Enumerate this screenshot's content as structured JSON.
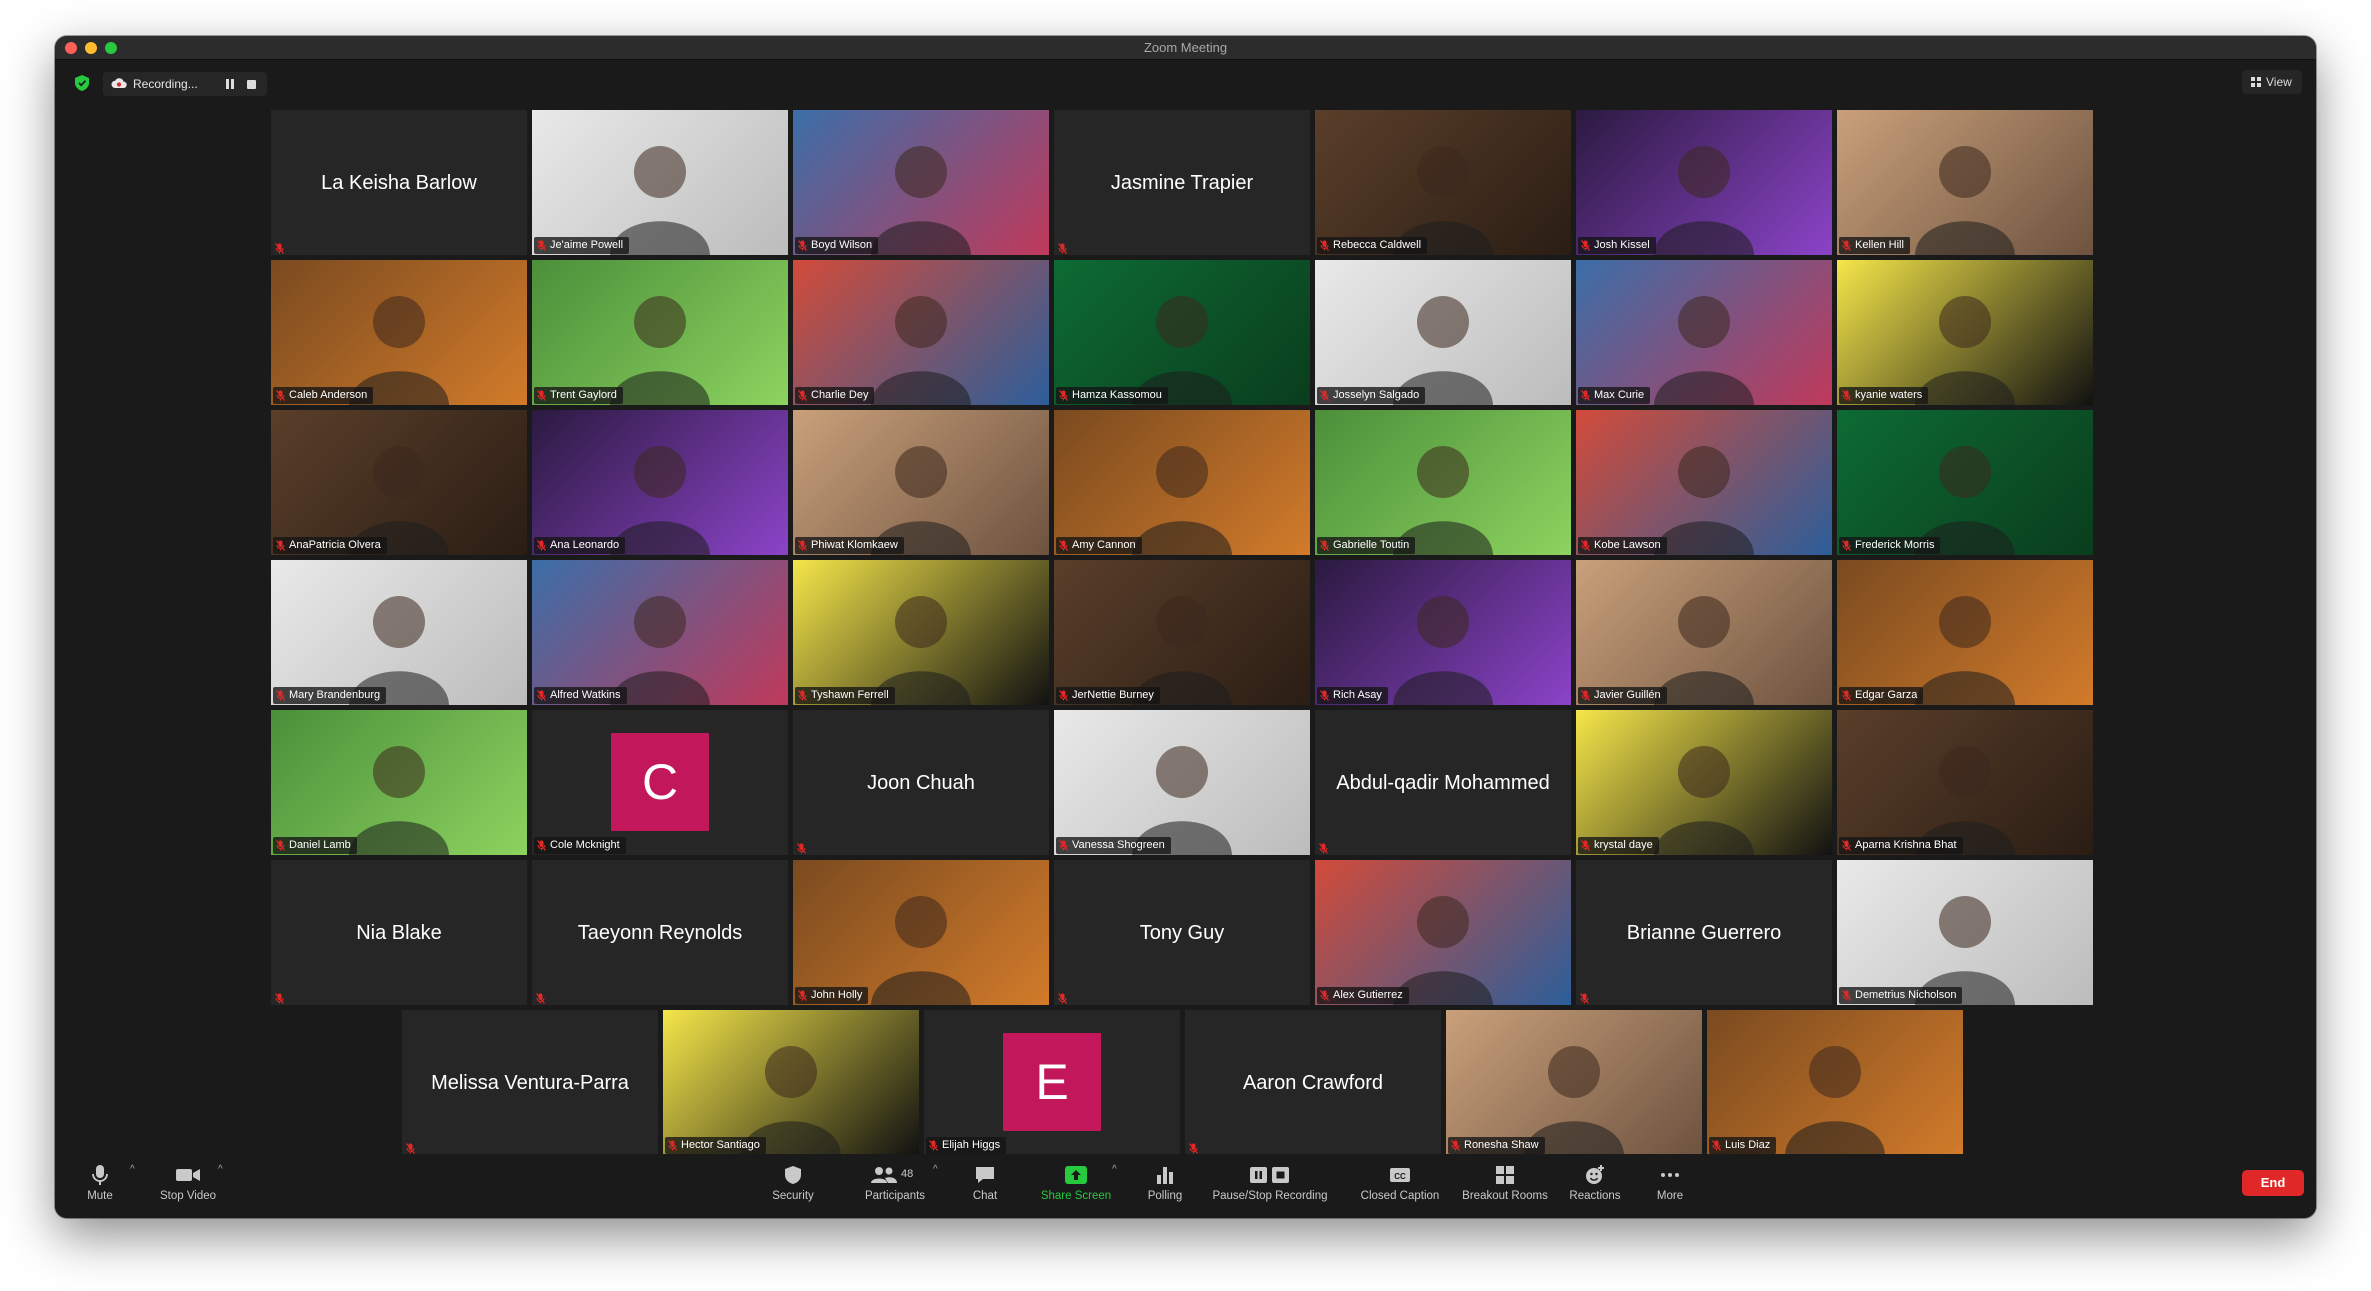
{
  "window": {
    "title": "Zoom Meeting"
  },
  "topbar": {
    "recording_label": "Recording...",
    "view_label": "View"
  },
  "colors": {
    "accent_green": "#27c93f",
    "end_red": "#e02828",
    "active_border": "#cddc39",
    "avatar_pink": "#c2185b"
  },
  "participants": [
    {
      "name": "La Keisha Barlow",
      "video": false
    },
    {
      "name": "Je'aime Powell",
      "video": true
    },
    {
      "name": "Boyd Wilson",
      "video": true
    },
    {
      "name": "Jasmine Trapier",
      "video": false
    },
    {
      "name": "Rebecca Caldwell",
      "video": true
    },
    {
      "name": "Josh Kissel",
      "video": true
    },
    {
      "name": "Kellen Hill",
      "video": true
    },
    {
      "name": "Caleb Anderson",
      "video": true
    },
    {
      "name": "Trent Gaylord",
      "video": true
    },
    {
      "name": "Charlie Dey",
      "video": true
    },
    {
      "name": "Hamza Kassomou",
      "video": true
    },
    {
      "name": "Josselyn Salgado",
      "video": true
    },
    {
      "name": "Max Curie",
      "video": true
    },
    {
      "name": "kyanie waters",
      "video": true
    },
    {
      "name": "AnaPatricia Olvera",
      "video": true
    },
    {
      "name": "Ana Leonardo",
      "video": true
    },
    {
      "name": "Phiwat Klomkaew",
      "video": true
    },
    {
      "name": "Amy Cannon",
      "video": true,
      "active": true
    },
    {
      "name": "Gabrielle Toutin",
      "video": true
    },
    {
      "name": "Kobe Lawson",
      "video": true
    },
    {
      "name": "Frederick Morris",
      "video": true
    },
    {
      "name": "Mary Brandenburg",
      "video": true
    },
    {
      "name": "Alfred Watkins",
      "video": true
    },
    {
      "name": "Tyshawn Ferrell",
      "video": true
    },
    {
      "name": "JerNettie Burney",
      "video": true
    },
    {
      "name": "Rich Asay",
      "video": true
    },
    {
      "name": "Javier Guillén",
      "video": true
    },
    {
      "name": "Edgar Garza",
      "video": true
    },
    {
      "name": "Daniel Lamb",
      "video": true
    },
    {
      "name": "Cole Mcknight",
      "video": false,
      "avatar": "C"
    },
    {
      "name": "Joon Chuah",
      "video": false
    },
    {
      "name": "Vanessa Shogreen",
      "video": true
    },
    {
      "name": "Abdul-qadir Mohammed",
      "video": false
    },
    {
      "name": "krystal daye",
      "video": true
    },
    {
      "name": "Aparna Krishna Bhat",
      "video": true
    },
    {
      "name": "Nia Blake",
      "video": false
    },
    {
      "name": "Taeyonn Reynolds",
      "video": false
    },
    {
      "name": "John Holly",
      "video": true
    },
    {
      "name": "Tony Guy",
      "video": false
    },
    {
      "name": "Alex Gutierrez",
      "video": true
    },
    {
      "name": "Brianne Guerrero",
      "video": false
    },
    {
      "name": "Demetrius Nicholson",
      "video": true
    },
    {
      "name": "Melissa Ventura-Parra",
      "video": false
    },
    {
      "name": "Hector Santiago",
      "video": true
    },
    {
      "name": "Elijah Higgs",
      "video": false,
      "avatar": "E"
    },
    {
      "name": "Aaron Crawford",
      "video": false
    },
    {
      "name": "Ronesha Shaw",
      "video": true
    },
    {
      "name": "Luis Diaz",
      "video": true
    }
  ],
  "toolbar": {
    "mute": "Mute",
    "stop_video": "Stop Video",
    "security": "Security",
    "participants": "Participants",
    "participant_count": "48",
    "chat": "Chat",
    "share_screen": "Share Screen",
    "polling": "Polling",
    "recording": "Pause/Stop Recording",
    "closed_caption": "Closed Caption",
    "breakout": "Breakout Rooms",
    "reactions": "Reactions",
    "more": "More",
    "end": "End"
  }
}
